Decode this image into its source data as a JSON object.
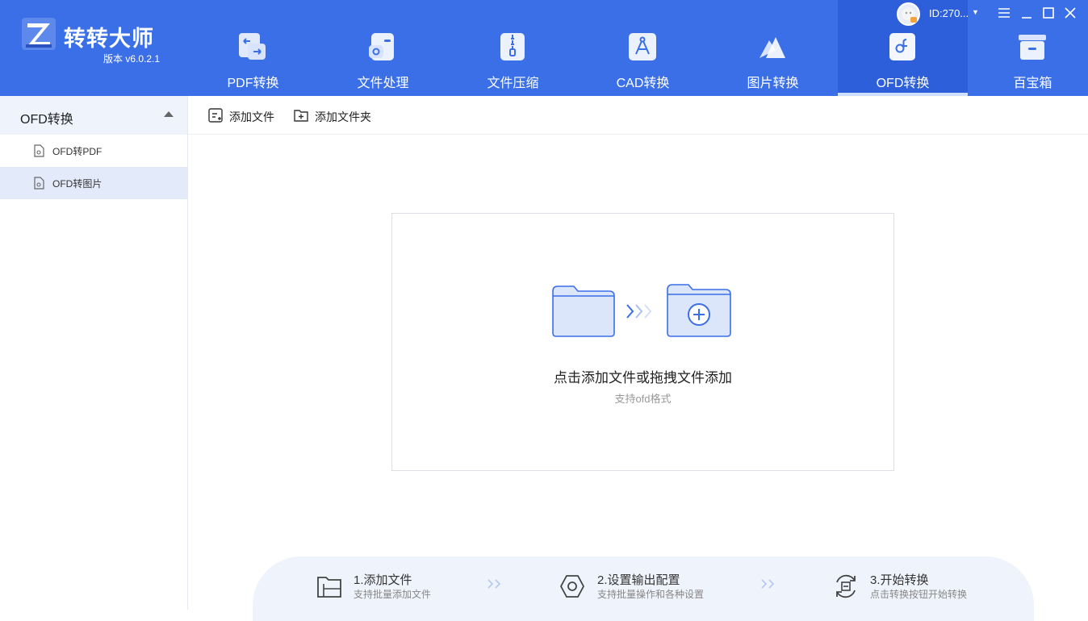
{
  "app": {
    "name": "转转大师",
    "version": "版本 v6.0.2.1"
  },
  "user": {
    "id": "ID:270..."
  },
  "colors": {
    "header": "#3a6fe8",
    "active_tab": "#2c5fd9",
    "accent": "#3a6fe8"
  },
  "tabs": [
    {
      "label": "PDF转换",
      "icon": "pdf-convert-icon"
    },
    {
      "label": "文件处理",
      "icon": "file-process-icon"
    },
    {
      "label": "文件压缩",
      "icon": "file-compress-icon"
    },
    {
      "label": "CAD转换",
      "icon": "cad-convert-icon"
    },
    {
      "label": "图片转换",
      "icon": "image-convert-icon"
    },
    {
      "label": "OFD转换",
      "icon": "ofd-convert-icon",
      "active": true
    },
    {
      "label": "百宝箱",
      "icon": "toolbox-icon"
    }
  ],
  "sidebar": {
    "title": "OFD转换",
    "items": [
      {
        "label": "OFD转PDF"
      },
      {
        "label": "OFD转图片",
        "selected": true
      }
    ]
  },
  "toolbar": {
    "add_file": "添加文件",
    "add_folder": "添加文件夹"
  },
  "dropzone": {
    "title": "点击添加文件或拖拽文件添加",
    "subtitle": "支持ofd格式"
  },
  "steps": [
    {
      "title": "1.添加文件",
      "subtitle": "支持批量添加文件"
    },
    {
      "title": "2.设置输出配置",
      "subtitle": "支持批量操作和各种设置"
    },
    {
      "title": "3.开始转换",
      "subtitle": "点击转换按钮开始转换"
    }
  ]
}
